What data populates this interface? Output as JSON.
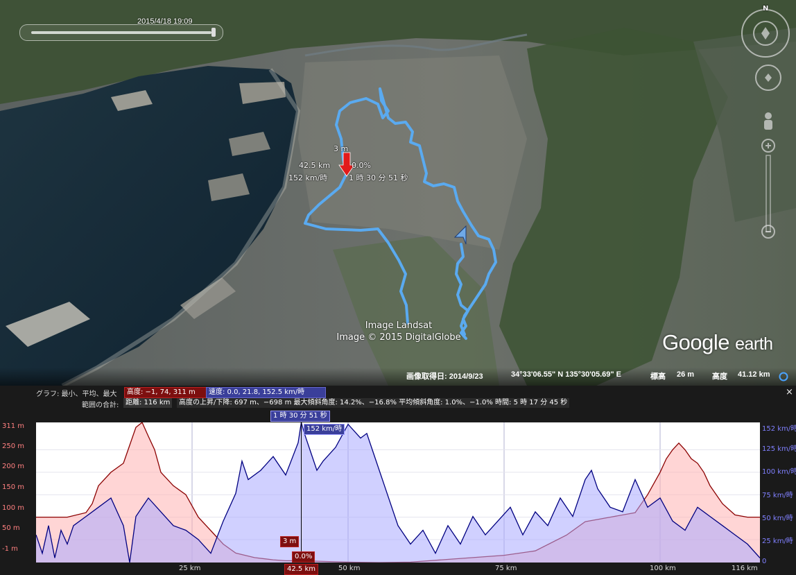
{
  "map": {
    "timestamp": "2015/4/18  19:09",
    "attribution_line1": "Image Landsat",
    "attribution_line2": "Image © 2015 DigitalGlobe",
    "logo_main": "Google",
    "logo_sub": "earth",
    "compass_north": "N",
    "marker": {
      "elevation": "3 m",
      "distance": "42.5 km",
      "grade": "0.0%",
      "speed": "152 km/時",
      "time": "1 時 30 分 51 秒"
    },
    "status": {
      "imagery_date": "画像取得日: 2014/9/23",
      "lat_lon": "34°33'06.55\" N  135°30'05.69\" E",
      "elevation_label": "標高",
      "elevation_value": "26 m",
      "eye_alt_label": "高度",
      "eye_alt_value": "41.12 km"
    },
    "colors": {
      "track": "#5aaaf0",
      "marker": "#e21b1b"
    }
  },
  "panel": {
    "row1_label": "グラフ: 最小、平均、最大",
    "altitude_chip": "高度: −1, 74, 311 m",
    "speed_chip": "速度: 0.0, 21.8, 152.5 km/時",
    "row2_label": "範囲の合計:",
    "distance_chip": "距離: 116 km",
    "summary_text": "高度の上昇/下降: 697 m、−698 m  最大傾斜角度: 14.2%、−16.8%  平均傾斜角度: 1.0%、−1.0%  時間: 5 時 17 分 45 秒",
    "close_icon": "×",
    "cursor_time": "1 時 30 分 51 秒",
    "cursor_speed": "152 km/時",
    "cursor_elev": "3 m",
    "cursor_grade": "0.0%",
    "cursor_distance": "42.5 km",
    "colors": {
      "elevation": "#8b0000",
      "elevation_fill": "#ffb3b3",
      "speed": "#000080",
      "speed_fill": "#aaaaff"
    }
  },
  "chart_data": {
    "type": "area",
    "title": "",
    "xlabel": "",
    "x_ticks": [
      "25 km",
      "50 km",
      "75 km",
      "100 km",
      "116 km"
    ],
    "xlim": [
      0,
      116
    ],
    "y_left_ticks": [
      "311 m",
      "250 m",
      "200 m",
      "150 m",
      "100 m",
      "50 m",
      "-1 m"
    ],
    "ylim_left": [
      -1,
      311
    ],
    "y_right_ticks": [
      "152 km/時",
      "125 km/時",
      "100 km/時",
      "75 km/時",
      "50 km/時",
      "25 km/時",
      "0"
    ],
    "ylim_right": [
      0,
      152
    ],
    "series": [
      {
        "name": "高度",
        "unit": "m",
        "x": [
          0,
          5,
          8,
          9,
          10,
          12,
          14,
          15,
          16,
          17,
          18,
          19,
          20,
          22,
          24,
          26,
          28,
          30,
          32,
          35,
          38,
          40,
          42.5,
          45,
          50,
          55,
          60,
          65,
          70,
          75,
          80,
          85,
          88,
          92,
          96,
          98,
          100,
          101,
          102,
          103,
          104,
          105,
          106,
          107,
          108,
          110,
          112,
          114,
          116
        ],
        "values": [
          100,
          100,
          110,
          130,
          170,
          200,
          220,
          260,
          300,
          311,
          280,
          250,
          200,
          170,
          150,
          100,
          70,
          40,
          20,
          10,
          5,
          3,
          3,
          2,
          0,
          -1,
          0,
          5,
          10,
          15,
          25,
          60,
          90,
          100,
          110,
          150,
          200,
          230,
          250,
          265,
          250,
          230,
          220,
          200,
          170,
          130,
          105,
          100,
          100
        ]
      },
      {
        "name": "速度",
        "unit": "km/時",
        "x": [
          0,
          1,
          2,
          3,
          4,
          5,
          6,
          8,
          10,
          12,
          14,
          15,
          16,
          17,
          18,
          20,
          22,
          24,
          26,
          28,
          30,
          32,
          33,
          34,
          36,
          38,
          40,
          42,
          42.5,
          43,
          44,
          45,
          46,
          48,
          50,
          52,
          53,
          54,
          56,
          58,
          60,
          62,
          64,
          66,
          68,
          70,
          72,
          74,
          76,
          78,
          80,
          82,
          84,
          86,
          88,
          89,
          90,
          92,
          94,
          96,
          98,
          100,
          102,
          104,
          106,
          108,
          110,
          112,
          114,
          116
        ],
        "values": [
          30,
          10,
          40,
          5,
          35,
          20,
          40,
          50,
          60,
          70,
          40,
          0,
          50,
          60,
          70,
          55,
          40,
          35,
          25,
          10,
          45,
          75,
          110,
          90,
          100,
          115,
          95,
          130,
          152,
          140,
          120,
          100,
          110,
          125,
          150,
          135,
          140,
          120,
          80,
          40,
          20,
          35,
          10,
          40,
          20,
          50,
          30,
          45,
          60,
          30,
          55,
          40,
          70,
          50,
          90,
          100,
          80,
          60,
          55,
          90,
          60,
          70,
          45,
          35,
          60,
          50,
          40,
          30,
          20,
          5
        ]
      }
    ],
    "cursor_x": 42.5,
    "grid": true
  }
}
